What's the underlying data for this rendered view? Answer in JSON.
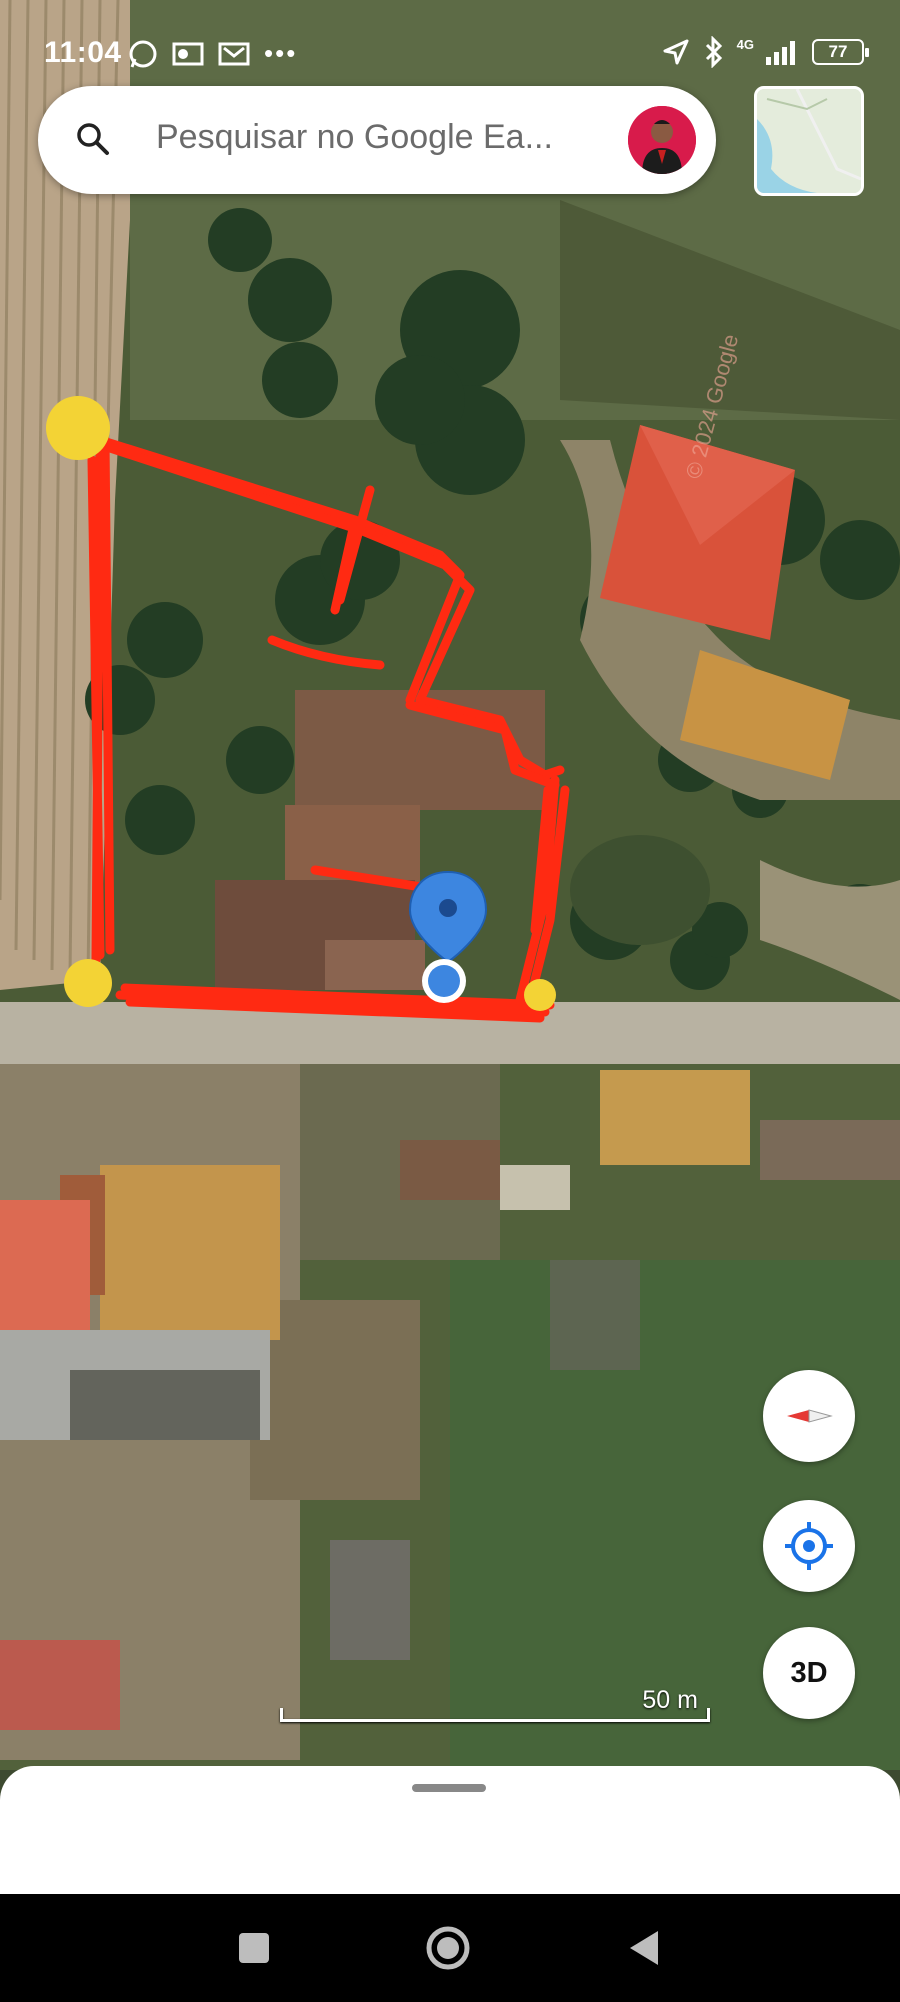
{
  "status_bar": {
    "time": "11:04",
    "battery": "77",
    "network": "4G"
  },
  "search": {
    "placeholder": "Pesquisar no Google Ea..."
  },
  "map": {
    "watermark": "© 2024 Google",
    "scale_label": "50 m"
  },
  "controls": {
    "three_d_label": "3D"
  },
  "icons": {
    "search": "search-icon",
    "compass": "compass-icon",
    "my_location": "my-location-icon",
    "location_pin": "location-pin-icon",
    "current_location": "current-location-dot",
    "nav_recents": "square-icon",
    "nav_home": "circle-icon",
    "nav_back": "triangle-back-icon"
  },
  "colors": {
    "annotation_red": "#ff2a12",
    "annotation_yellow": "#f3d335",
    "pin_blue": "#3d86e0"
  }
}
